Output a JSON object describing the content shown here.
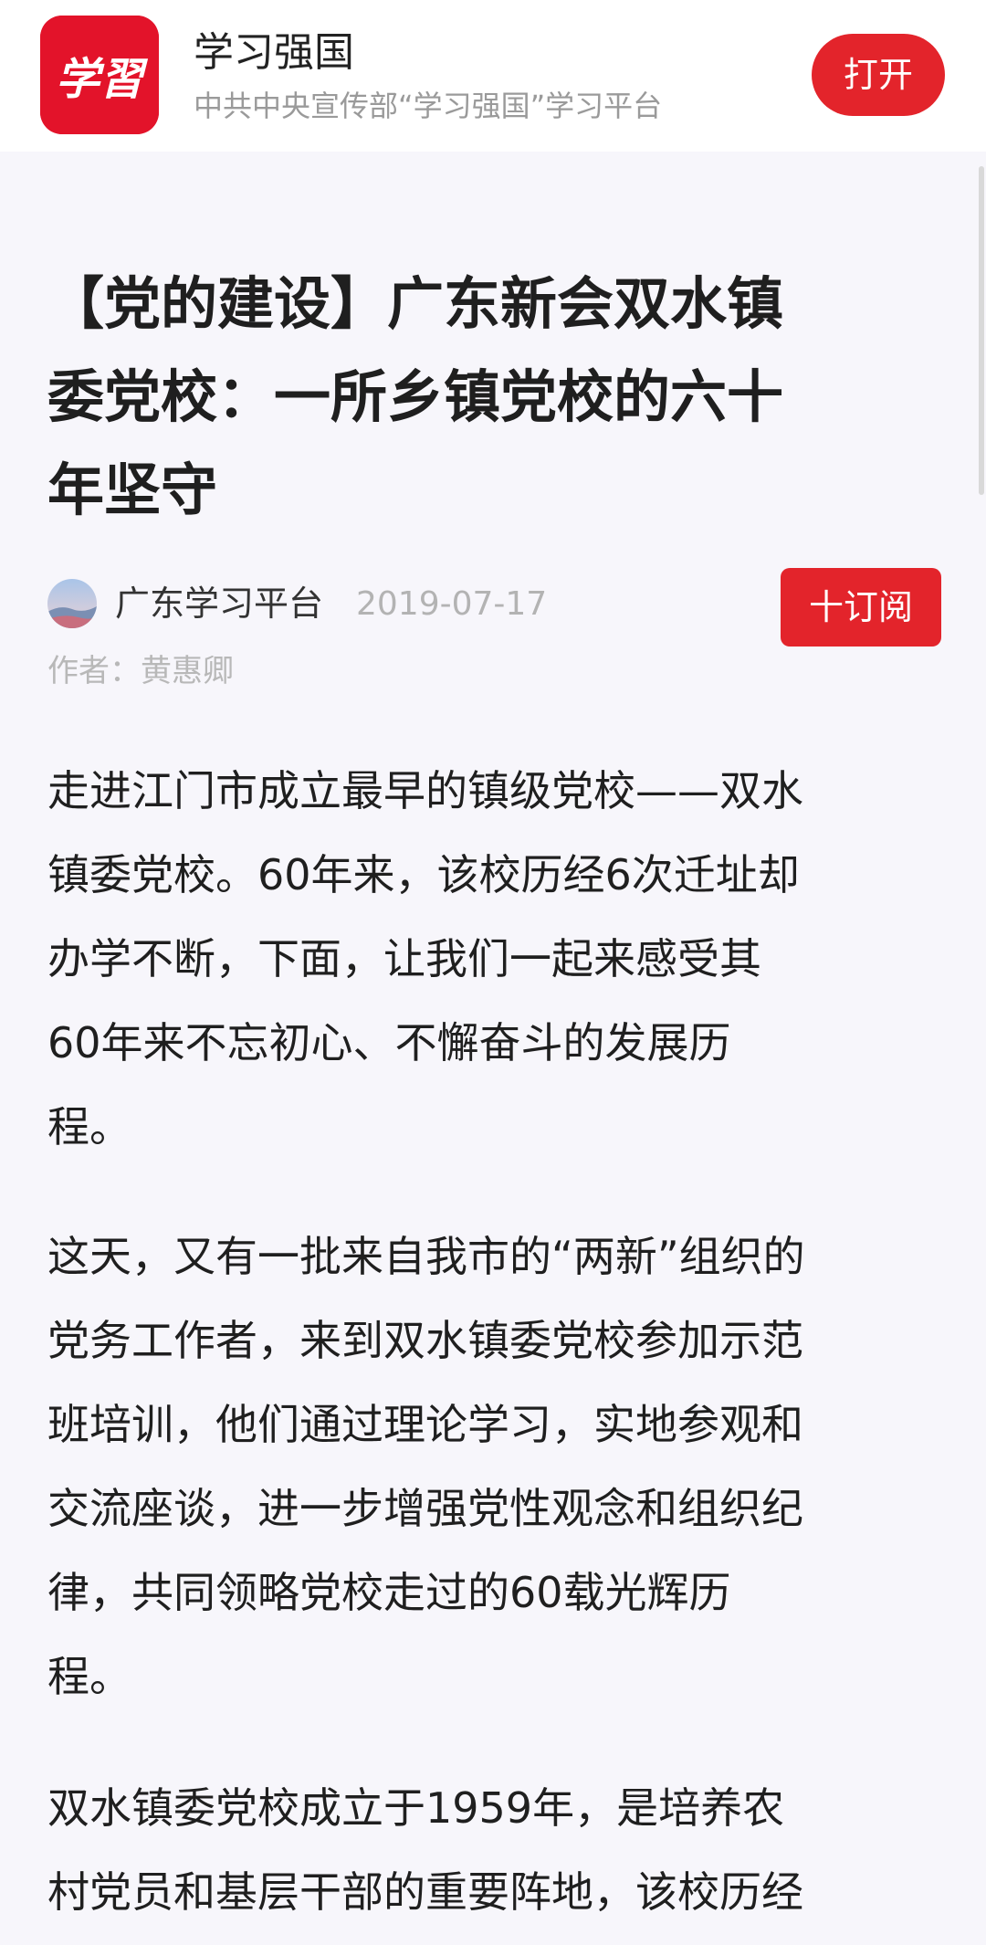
{
  "app_banner": {
    "name": "学习强国",
    "description": "中共中央宣传部“学习强国”学习平台",
    "open_label": "打开",
    "logo_text": "学習",
    "accent_color": "#e3242b"
  },
  "article": {
    "title_lines": [
      "【党的建设】广东新会双水镇",
      "委党校：一所乡镇党校的六十",
      "年坚守"
    ],
    "channel": "广东学习平台",
    "date": "2019-07-17",
    "subscribe_label": "十订阅",
    "author": "作者：黄惠卿",
    "paragraphs": [
      {
        "lines": [
          "走进江门市成立最早的镇级党校——双水",
          "镇委党校。60年来，该校历经6次迁址却",
          "办学不断，下面，让我们一起来感受其",
          "60年来不忘初心、不懈奋斗的发展历",
          "程。"
        ]
      },
      {
        "lines": [
          "这天，又有一批来自我市的“两新”组织的",
          "党务工作者，来到双水镇委党校参加示范",
          "班培训，他们通过理论学习，实地参观和",
          "交流座谈，进一步增强党性观念和组织纪",
          "律，共同领略党校走过的60载光辉历",
          "程。"
        ]
      },
      {
        "lines": [
          "双水镇委党校成立于1959年，是培养农",
          "村党员和基层干部的重要阵地，该校历经"
        ]
      }
    ]
  }
}
